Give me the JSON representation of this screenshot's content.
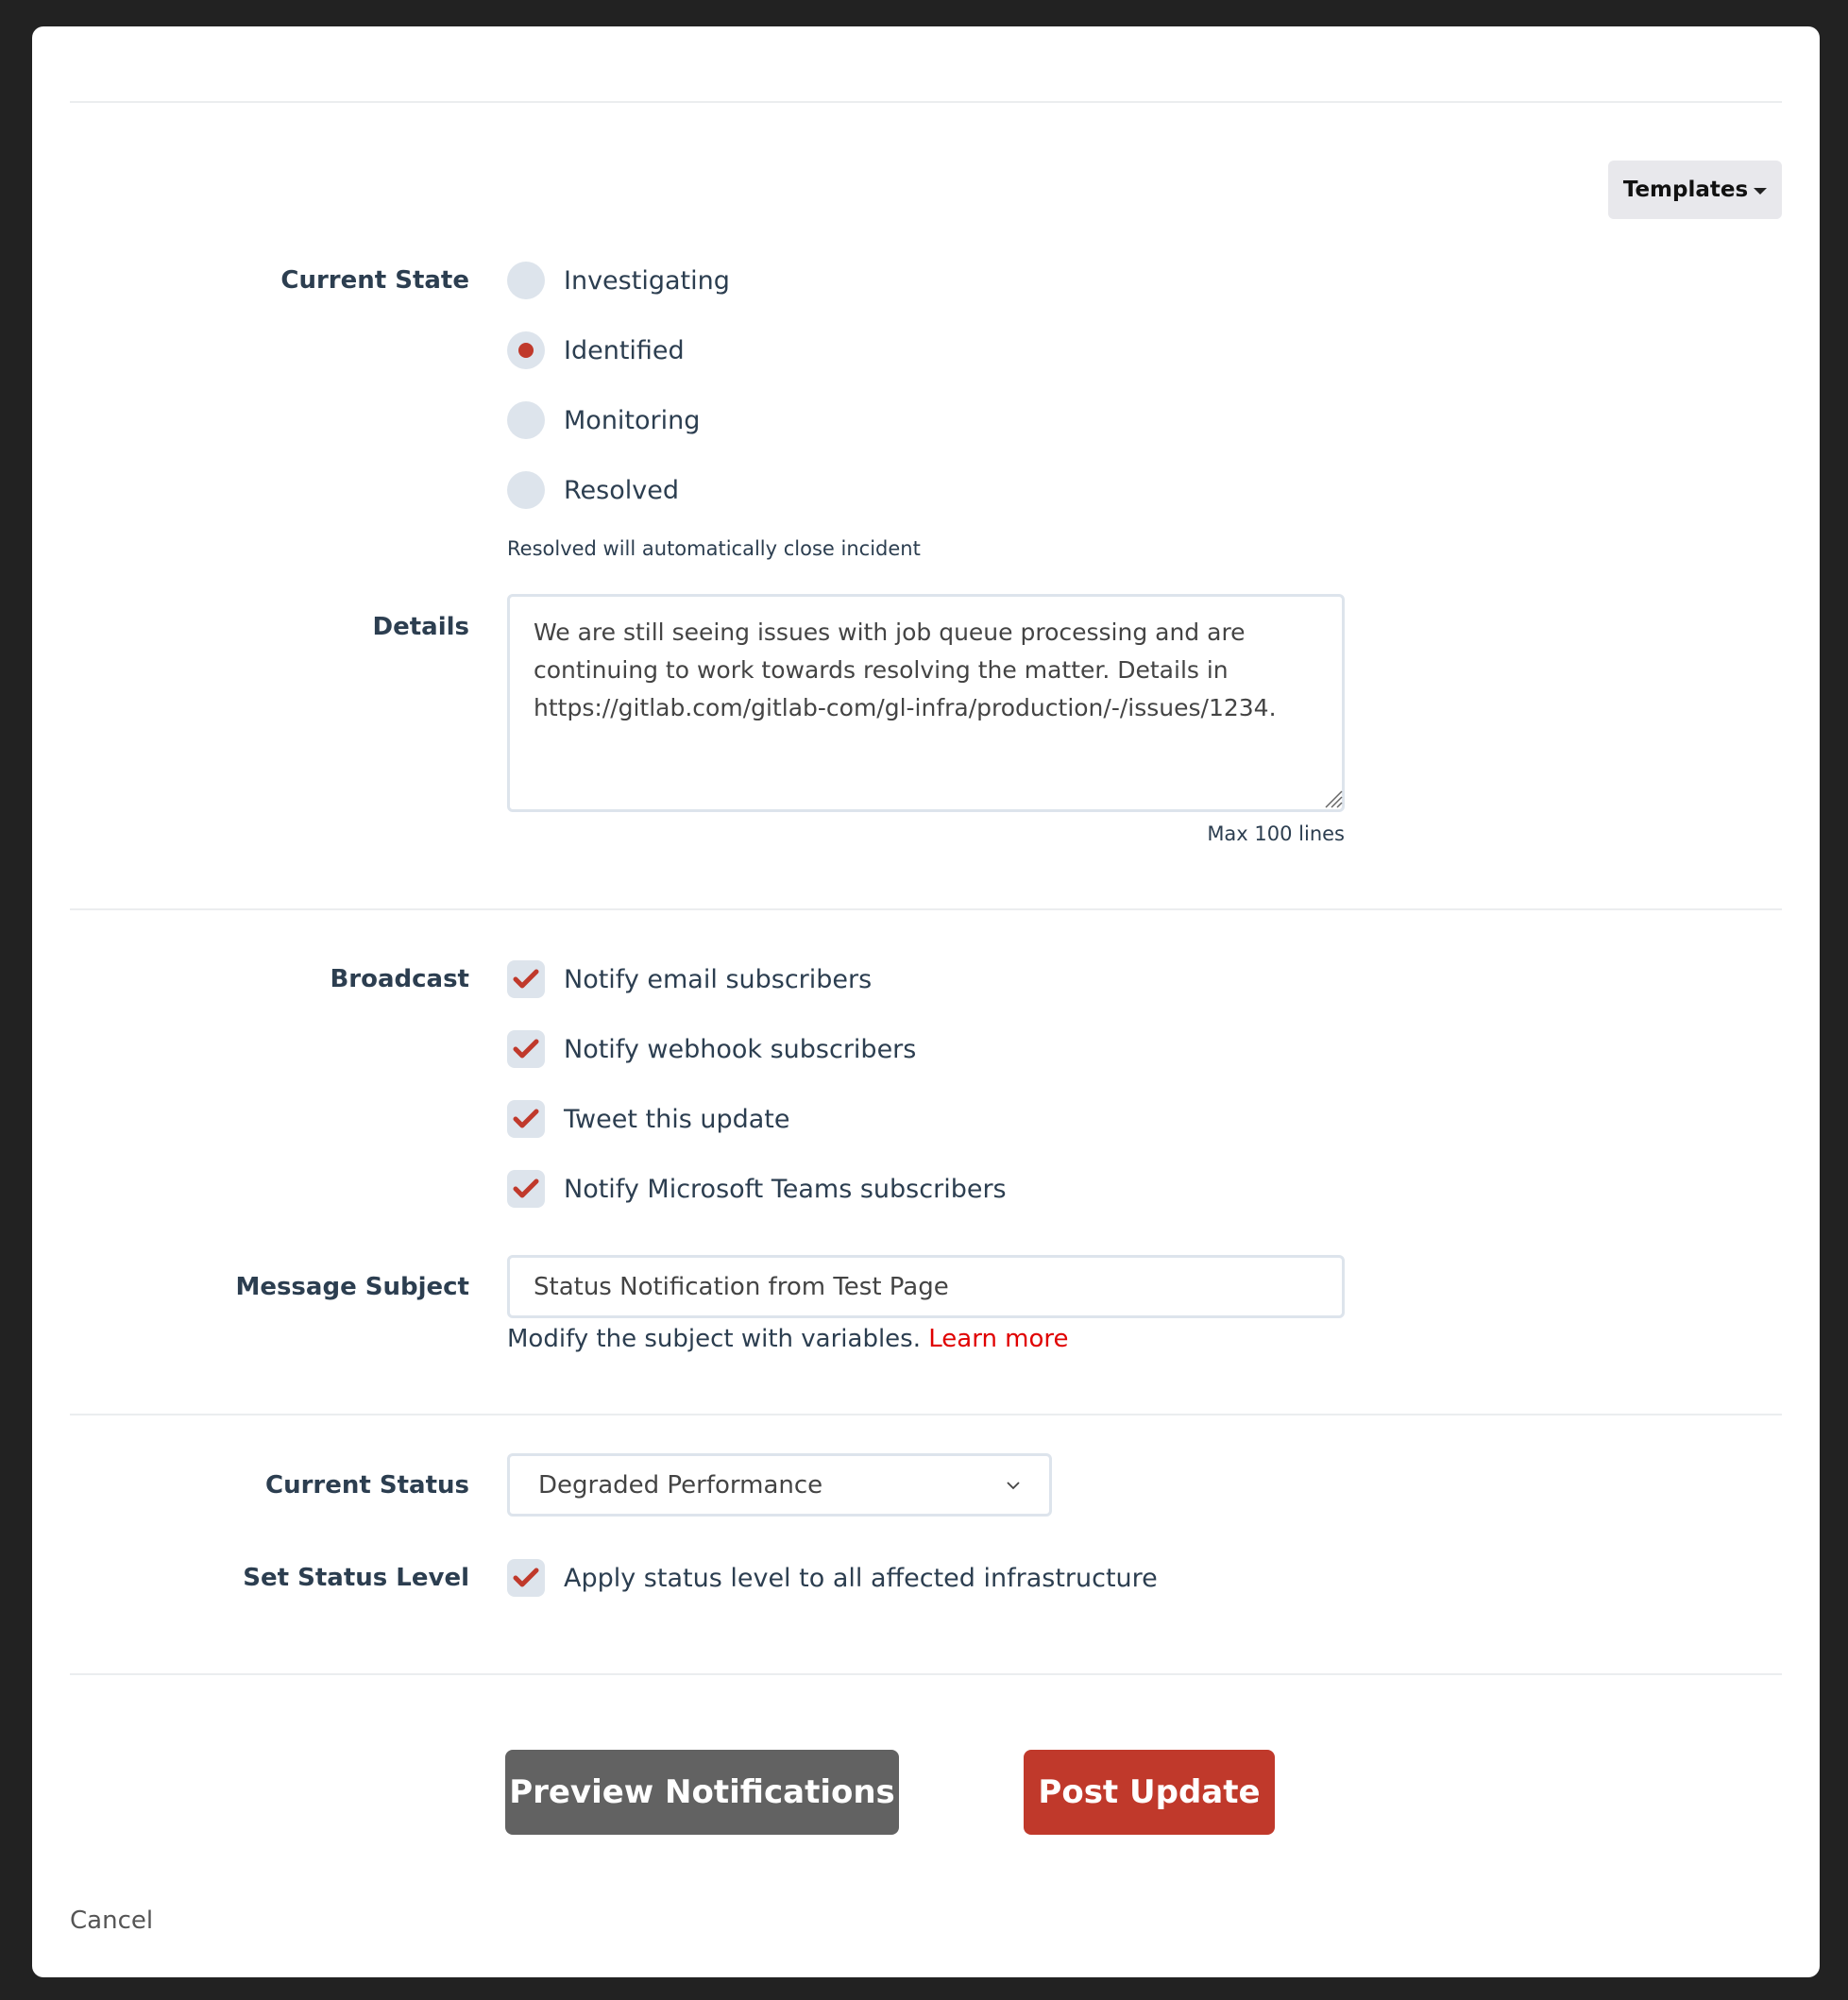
{
  "toolbar": {
    "templates_label": "Templates"
  },
  "current_state": {
    "label": "Current State",
    "options": [
      {
        "label": "Investigating",
        "selected": false
      },
      {
        "label": "Identified",
        "selected": true
      },
      {
        "label": "Monitoring",
        "selected": false
      },
      {
        "label": "Resolved",
        "selected": false
      }
    ],
    "helper": "Resolved will automatically close incident"
  },
  "details": {
    "label": "Details",
    "value": "We are still seeing issues with job queue processing and are continuing to work towards resolving the matter. Details in https://gitlab.com/gitlab-com/gl-infra/production/-/issues/1234.",
    "max_lines_note": "Max 100 lines"
  },
  "broadcast": {
    "label": "Broadcast",
    "options": [
      {
        "label": "Notify email subscribers",
        "checked": true
      },
      {
        "label": "Notify webhook subscribers",
        "checked": true
      },
      {
        "label": "Tweet this update",
        "checked": true
      },
      {
        "label": "Notify Microsoft Teams subscribers",
        "checked": true
      }
    ]
  },
  "message_subject": {
    "label": "Message Subject",
    "value": "Status Notification from Test Page",
    "helper": "Modify the subject with variables.",
    "learn_more": "Learn more"
  },
  "current_status": {
    "label": "Current Status",
    "selected": "Degraded Performance"
  },
  "set_status_level": {
    "label": "Set Status Level",
    "option": {
      "label": "Apply status level to all affected infrastructure",
      "checked": true
    }
  },
  "actions": {
    "preview_label": "Preview Notifications",
    "post_label": "Post Update",
    "cancel_label": "Cancel"
  },
  "colors": {
    "accent": "#c0392b",
    "preview_button": "#626262",
    "link": "#e00000",
    "control_bg": "#dde4ec"
  }
}
